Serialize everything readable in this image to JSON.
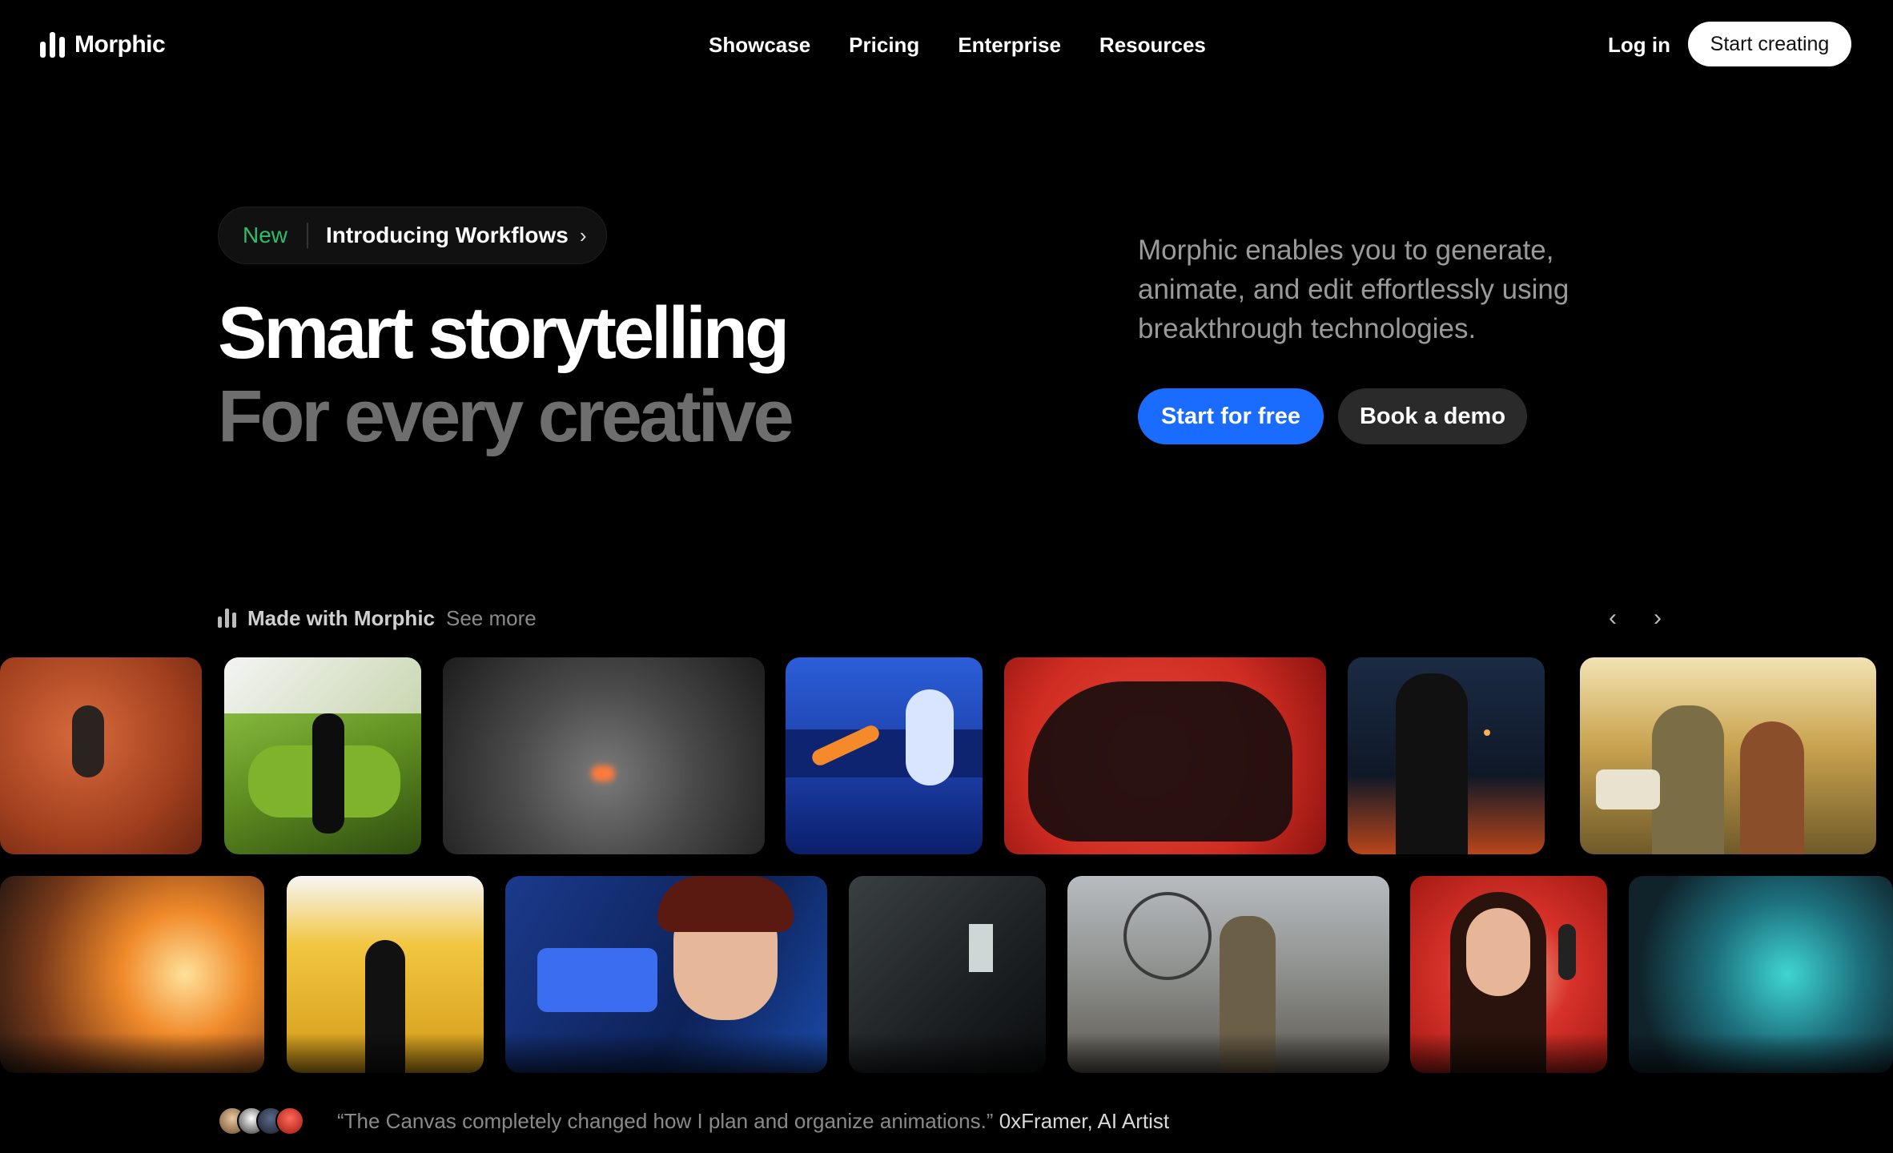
{
  "brand": {
    "name": "Morphic"
  },
  "nav": {
    "links": [
      "Showcase",
      "Pricing",
      "Enterprise",
      "Resources"
    ],
    "login": "Log in",
    "cta": "Start creating"
  },
  "hero": {
    "badge_new": "New",
    "badge_text": "Introducing Workflows",
    "headline": "Smart storytelling",
    "subheadline": "For every creative",
    "description": "Morphic enables you to generate, animate, and edit effortlessly using breakthrough technologies.",
    "primary_button": "Start for free",
    "secondary_button": "Book a demo"
  },
  "gallery": {
    "title": "Made with Morphic",
    "see_more": "See more",
    "prev_icon": "chevron-left-icon",
    "next_icon": "chevron-right-icon"
  },
  "testimonial": {
    "quote": "“The Canvas completely changed how I plan and organize animations.”",
    "author": "0xFramer, AI Artist"
  },
  "colors": {
    "background": "#000000",
    "accent_blue": "#1a6bff",
    "new_green": "#2ebd6b"
  }
}
